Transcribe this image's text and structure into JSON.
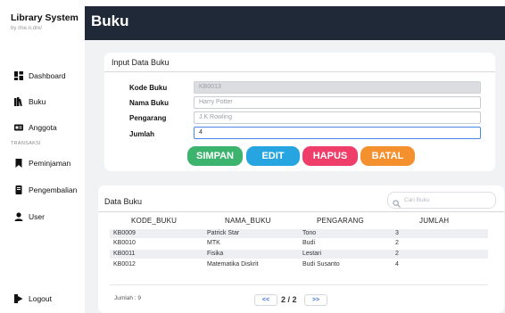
{
  "sidebar": {
    "app_title": "Library System",
    "app_subtitle": "by /me.n.dre/",
    "section_label": "TRANSAKSI",
    "items": [
      {
        "label": "Dashboard",
        "icon": "dashboard-icon"
      },
      {
        "label": "Buku",
        "icon": "books-icon"
      },
      {
        "label": "Anggota",
        "icon": "id-card-icon"
      },
      {
        "label": "Peminjaman",
        "icon": "bookmark-icon"
      },
      {
        "label": "Pengembalian",
        "icon": "book-return-icon"
      },
      {
        "label": "User",
        "icon": "user-icon"
      }
    ],
    "logout_label": "Logout"
  },
  "header": {
    "title": "Buku"
  },
  "form": {
    "title": "Input Data Buku",
    "fields": [
      {
        "label": "Kode Buku",
        "value": "KB0013"
      },
      {
        "label": "Nama Buku",
        "value": "Harry Potter"
      },
      {
        "label": "Pengarang",
        "value": "J.K Rowling"
      },
      {
        "label": "Jumlah",
        "value": "4"
      }
    ],
    "buttons": {
      "simpan": "SIMPAN",
      "edit": "EDIT",
      "hapus": "HAPUS",
      "batal": "BATAL"
    }
  },
  "table": {
    "title": "Data Buku",
    "search_placeholder": "Cari Buku",
    "columns": [
      "KODE_BUKU",
      "NAMA_BUKU",
      "PENGARANG",
      "JUMLAH"
    ],
    "rows": [
      [
        "KB0009",
        "Patrick Star",
        "Tono",
        "3"
      ],
      [
        "KB0010",
        "MTK",
        "Budi",
        "2"
      ],
      [
        "KB0011",
        "Fisika",
        "Lestari",
        "2"
      ],
      [
        "KB0012",
        "Matematika Diskrit",
        "Budi Susanto",
        "4"
      ]
    ],
    "total": "Jumlah : 9",
    "pager": {
      "prev": "<<",
      "page": "2 / 2",
      "next": ">>"
    }
  },
  "colors": {
    "header_bg": "#1f2937",
    "simpan": "#3cb46e",
    "edit": "#27a5e0",
    "hapus": "#ef3e6a",
    "batal": "#f5902e"
  }
}
